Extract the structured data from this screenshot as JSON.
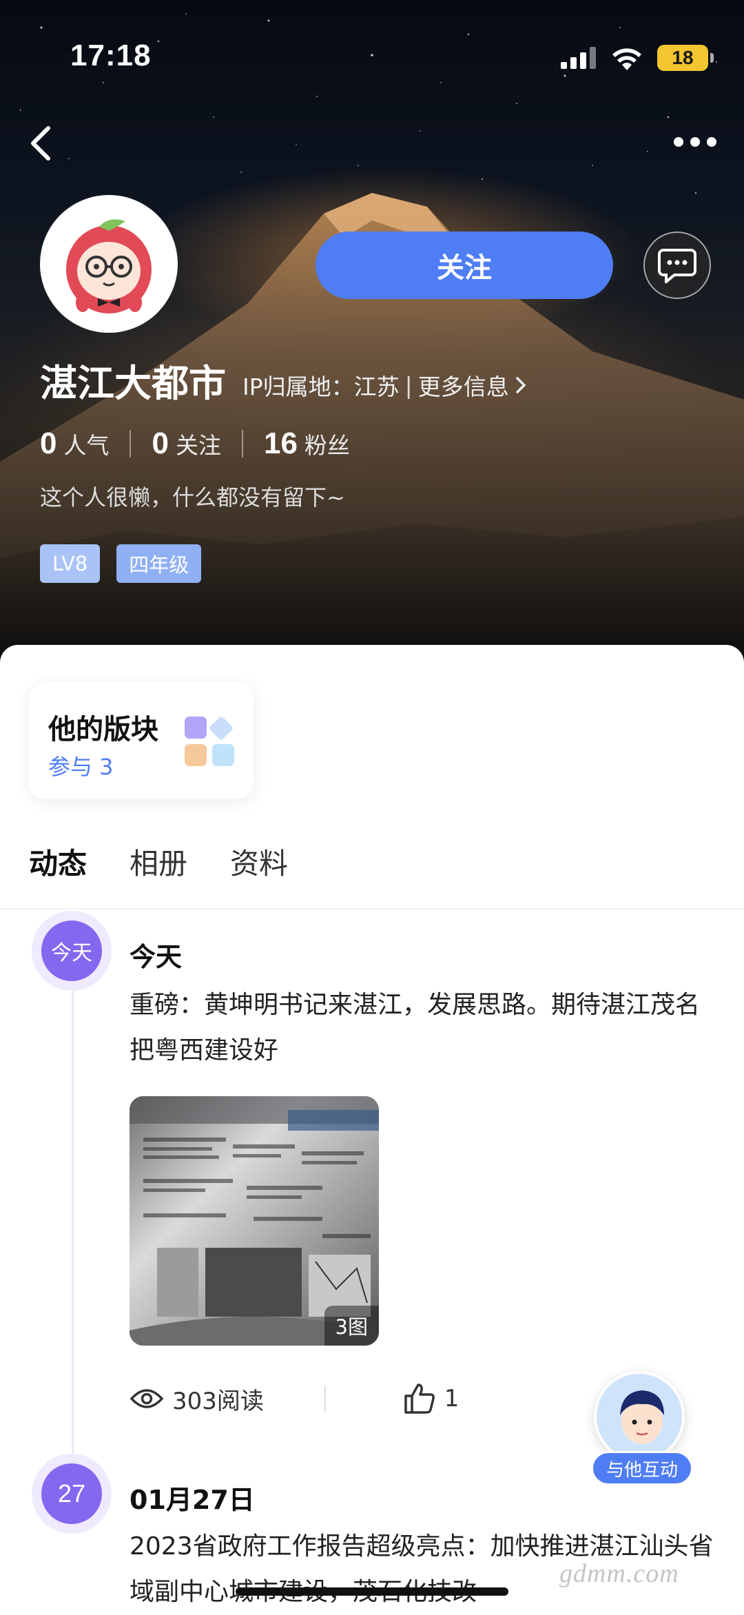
{
  "status_bar": {
    "time": "17:18",
    "battery": "18"
  },
  "profile": {
    "name": "湛江大都市",
    "ip_label": "IP归属地：江苏",
    "more_info": "更多信息",
    "follow_label": "关注",
    "stats": [
      {
        "value": "0",
        "label": "人气"
      },
      {
        "value": "0",
        "label": "关注"
      },
      {
        "value": "16",
        "label": "粉丝"
      }
    ],
    "bio": "这个人很懒，什么都没有留下~",
    "badges": [
      "LV8",
      "四年级"
    ]
  },
  "board_card": {
    "title": "他的版块",
    "subtitle": "参与 3"
  },
  "tabs": [
    "动态",
    "相册",
    "资料"
  ],
  "posts": [
    {
      "dot_label": "今天",
      "date": "今天",
      "text": "重磅：黄坤明书记来湛江，发展思路。期待湛江茂名把粤西建设好",
      "image_count": "3图",
      "reads": "303阅读",
      "likes": "1"
    },
    {
      "dot_label": "27",
      "date": "01月27日",
      "text": "2023省政府工作报告超级亮点：加快推进湛江汕头省域副中心城市建设，茂石化技改"
    }
  ],
  "interact_label": "与他互动",
  "watermark": "gdmm.com"
}
